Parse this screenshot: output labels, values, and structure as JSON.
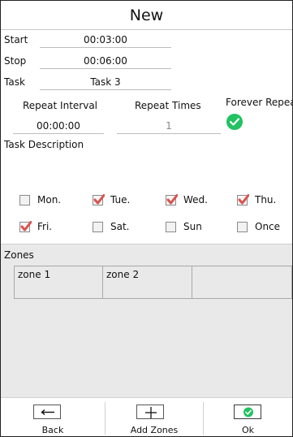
{
  "header": {
    "title": "New"
  },
  "fields": {
    "start": {
      "label": "Start",
      "value": "00:03:00"
    },
    "stop": {
      "label": "Stop",
      "value": "00:06:00"
    },
    "task": {
      "label": "Task",
      "value": "Task 3"
    }
  },
  "repeat": {
    "interval_label": "Repeat Interval",
    "interval_value": "00:00:00",
    "times_label": "Repeat Times",
    "times_value": "1",
    "forever_label": "Forever Repeat",
    "forever_checked": true,
    "forever_icon": "check-circle-icon",
    "accent_color": "#22c162"
  },
  "task_description": {
    "label": "Task Description"
  },
  "days": [
    {
      "label": "Mon.",
      "checked": false
    },
    {
      "label": "Tue.",
      "checked": true
    },
    {
      "label": "Wed.",
      "checked": true
    },
    {
      "label": "Thu.",
      "checked": true
    },
    {
      "label": "Fri.",
      "checked": true
    },
    {
      "label": "Sat.",
      "checked": false
    },
    {
      "label": "Sun",
      "checked": false
    },
    {
      "label": "Once",
      "checked": false
    }
  ],
  "zones": {
    "label": "Zones",
    "items": [
      "zone 1",
      "zone 2",
      ""
    ]
  },
  "toolbar": {
    "back_label": "Back",
    "back_icon": "arrow-left-icon",
    "add_label": "Add Zones",
    "add_icon": "plus-icon",
    "ok_label": "Ok",
    "ok_icon": "check-circle-icon"
  }
}
